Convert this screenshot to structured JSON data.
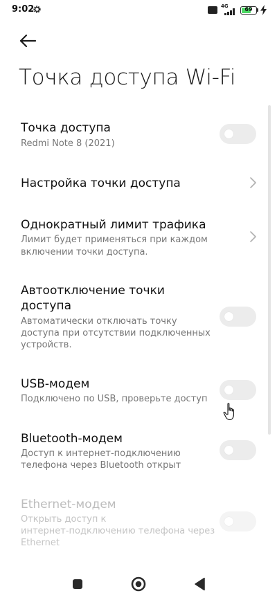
{
  "status_bar": {
    "time": "9:02",
    "network": "4G",
    "battery_level": "69",
    "battery_fraction": 0.69,
    "icons": [
      "gear-icon",
      "sim-icon",
      "signal-icon",
      "battery-icon",
      "charging-bolt-icon"
    ]
  },
  "header": {
    "back_icon": "arrow-left-icon",
    "title": "Точка доступа Wi-Fi"
  },
  "settings": {
    "hotspot": {
      "title": "Точка доступа",
      "subtitle": "Redmi Note 8 (2021)",
      "enabled": false
    },
    "hotspot_setup": {
      "title": "Настройка точки доступа"
    },
    "data_limit": {
      "title": "Однократный лимит трафика",
      "subtitle_line1": "Лимит будет применяться при каждом",
      "subtitle_line2": "включении точки доступа."
    },
    "auto_off": {
      "title_line1": "Автоотключение точки",
      "title_line2": "доступа",
      "subtitle_line1": "Автоматически отключать точку",
      "subtitle_line2": "доступа при отсутствии подключенных",
      "subtitle_line3": "устройств.",
      "enabled": false
    },
    "usb_tethering": {
      "title": "USB-модем",
      "subtitle": "Подключено по USB, проверьте доступ",
      "enabled": false
    },
    "bluetooth_tethering": {
      "title": "Bluetooth-модем",
      "subtitle_line1": "Доступ к интернет-подключению",
      "subtitle_line2": "телефона через Bluetooth открыт",
      "enabled": false
    },
    "ethernet_tethering": {
      "title": "Ethernet-модем",
      "subtitle_line1": "Открыть доступ к",
      "subtitle_line2": "интернет-подключению телефона через",
      "subtitle_line3": "Ethernet",
      "enabled": false,
      "disabled": true
    }
  },
  "colors": {
    "toggle_off": "#ececec",
    "battery_fill": "#4cd964",
    "disabled_text": "#bdbdbd"
  },
  "nav_bar": {
    "icons": [
      "recents-square-icon",
      "home-circle-icon",
      "back-triangle-icon"
    ]
  }
}
